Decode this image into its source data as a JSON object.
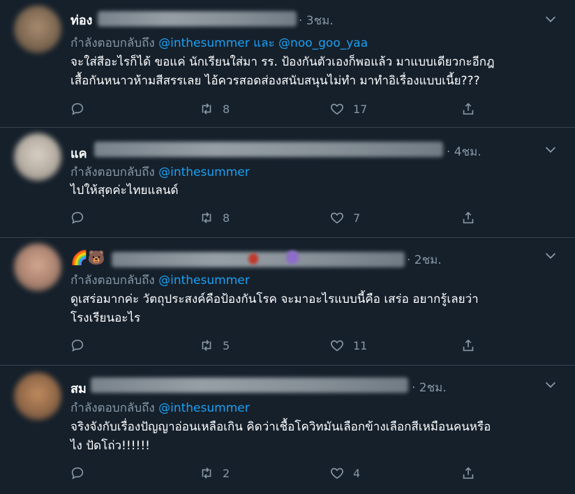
{
  "replying_to_prefix": "กำลังตอบกลับถึง",
  "and_word": "และ",
  "tweets": [
    {
      "name_visible": "ท่อง",
      "time": "· 3ชม.",
      "mentions": [
        "@inthesummer",
        "@noo_goo_yaa"
      ],
      "text_lines": [
        "จะใส่สีอะไรก็ได้ ขอแค่ นักเรียนใส่มา รร. ป้องกันตัวเองก็พอแล้ว  มาแบบเดียวกะอีกฎ",
        "เสื้อกันหนาวห้ามสีสรรเลย ไอ้ควรสอดส่องสนับสนุนไม่ทำ มาทำอิเรื่องแบบเนี้ย???"
      ],
      "retweets": "8",
      "likes": "17"
    },
    {
      "name_visible": "แค",
      "time": "· 4ชม.",
      "mentions": [
        "@inthesummer"
      ],
      "text_lines": [
        "ไปให้สุดค่ะไทยแลนด์"
      ],
      "retweets": "8",
      "likes": "7"
    },
    {
      "name_visible": "🌈🐻",
      "time": "· 2ชม.",
      "mentions": [
        "@inthesummer"
      ],
      "text_lines": [
        "ดูเสร่อมากค่ะ วัตถุประสงค์คือป้องกันโรค จะมาอะไรแบบนี้คือ เสร่อ อยากรู้เลยว่า",
        "โรงเรียนอะไร"
      ],
      "retweets": "5",
      "likes": "11"
    },
    {
      "name_visible": "สม",
      "time": "· 2ชม.",
      "mentions": [
        "@inthesummer"
      ],
      "text_lines": [
        "จริงจังกับเรื่องปัญญาอ่อนเหลือเกิน คิดว่าเชื้อโควิทมันเลือกข้างเลือกสีเหมือนคนหรือ",
        "ไง ปัดโถ่ว!!!!!!"
      ],
      "retweets": "2",
      "likes": "4"
    }
  ],
  "colors": {
    "background": "#15202b",
    "muted": "#8899a6",
    "link": "#1da1f2",
    "divider": "#38444d"
  },
  "icons": [
    "reply-icon",
    "retweet-icon",
    "like-icon",
    "share-icon",
    "chevron-down-icon"
  ]
}
